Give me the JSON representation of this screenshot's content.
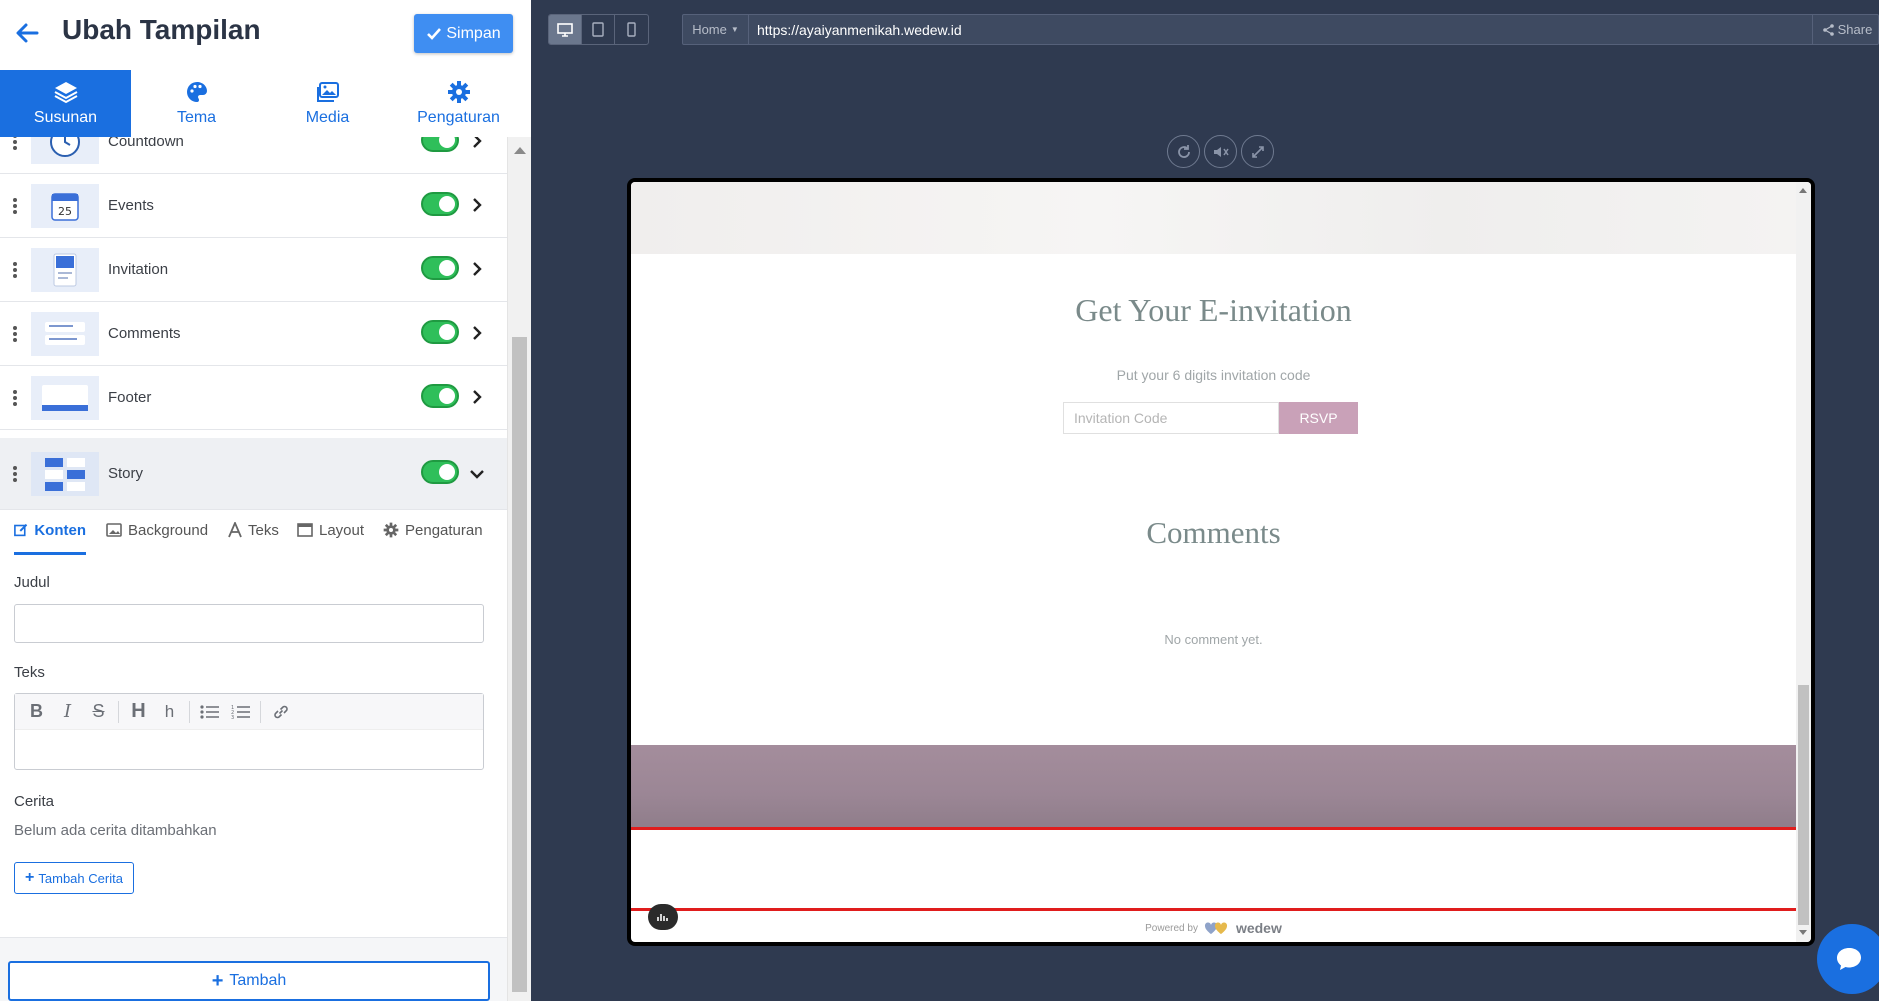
{
  "header": {
    "title": "Ubah Tampilan",
    "save_label": "Simpan"
  },
  "main_tabs": [
    {
      "label": "Susunan",
      "icon": "layers-icon",
      "active": true
    },
    {
      "label": "Tema",
      "icon": "palette-icon",
      "active": false
    },
    {
      "label": "Media",
      "icon": "images-icon",
      "active": false
    },
    {
      "label": "Pengaturan",
      "icon": "gear-icon",
      "active": false
    }
  ],
  "sections": [
    {
      "name": "Countdown",
      "enabled": true
    },
    {
      "name": "Events",
      "enabled": true
    },
    {
      "name": "Invitation",
      "enabled": true
    },
    {
      "name": "Comments",
      "enabled": true
    },
    {
      "name": "Footer",
      "enabled": true
    },
    {
      "name": "Story",
      "enabled": true,
      "expanded": true
    }
  ],
  "events_thumb_day": "25",
  "sub_tabs": [
    {
      "label": "Konten",
      "active": true
    },
    {
      "label": "Background",
      "active": false
    },
    {
      "label": "Teks",
      "active": false
    },
    {
      "label": "Layout",
      "active": false
    },
    {
      "label": "Pengaturan",
      "active": false
    }
  ],
  "form": {
    "judul_label": "Judul",
    "judul_value": "",
    "teks_label": "Teks",
    "cerita_label": "Cerita",
    "cerita_empty": "Belum ada cerita ditambahkan",
    "add_story_label": "Tambah Cerita"
  },
  "add_button_label": "Tambah",
  "preview": {
    "page_select": "Home",
    "url": "https://ayaiyanmenikah.wedew.id",
    "share_label": "Share",
    "einvitation_title": "Get Your E-invitation",
    "einvitation_sub": "Put your 6 digits invitation code",
    "code_placeholder": "Invitation Code",
    "rsvp_label": "RSVP",
    "comments_title": "Comments",
    "no_comment": "No comment yet.",
    "powered_by": "Powered by",
    "brand": "wedew"
  },
  "colors": {
    "primary": "#1a6fe0",
    "save_button": "#3f8ef2",
    "toggle_on": "#2fbf5a",
    "rsvp": "#c9a1b8",
    "highlight": "#e01d1d",
    "preview_bg": "#2f3a50"
  }
}
